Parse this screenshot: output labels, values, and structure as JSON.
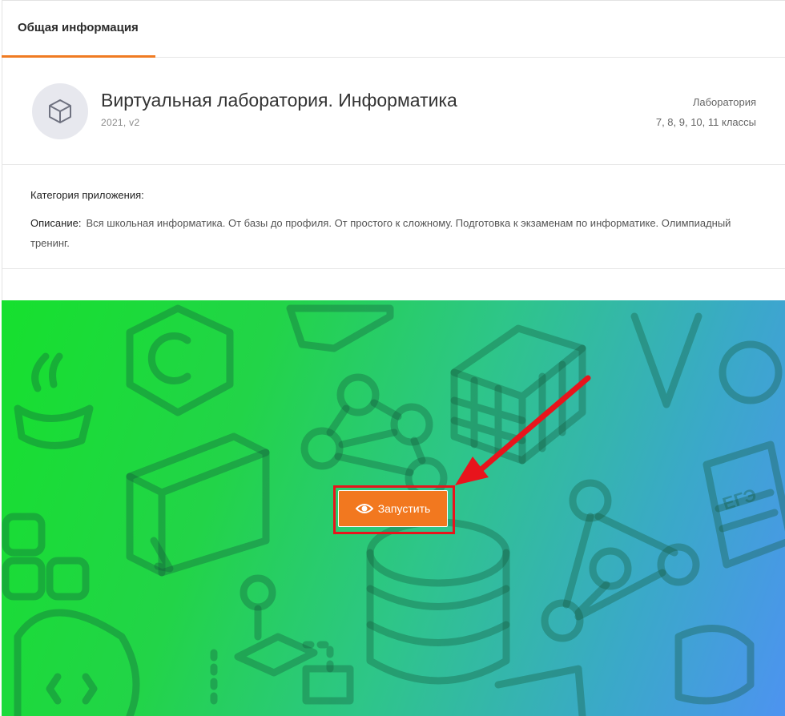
{
  "tabs": {
    "general_info": "Общая информация"
  },
  "app": {
    "title": "Виртуальная лаборатория. Информатика",
    "version": "2021, v2",
    "type": "Лаборатория",
    "grades": "7, 8, 9, 10, 11 классы",
    "logo_icon": "cube-icon"
  },
  "info": {
    "category_label": "Категория приложения:",
    "description_label": "Описание:",
    "description_text": "Вся школьная информатика. От базы до профиля. От простого к сложному. Подготовка к экзаменам по информатике. Олимпиадный тренинг."
  },
  "banner": {
    "launch_label": "Запустить",
    "launch_icon": "eye-icon",
    "exam_label": "ЕГЭ",
    "accent_color": "#f2781f",
    "highlight_color": "#e8141c"
  }
}
